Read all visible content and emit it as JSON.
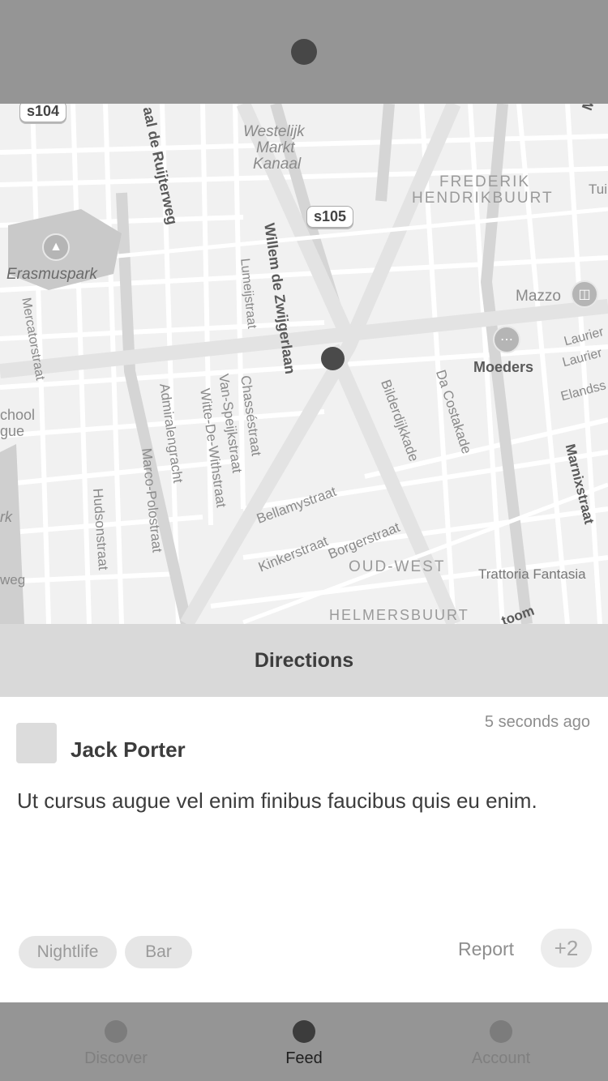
{
  "map": {
    "labels": {
      "westelijk": "Westelijk",
      "markt": "Markt",
      "kanaal": "Kanaal",
      "frederik": "FREDERIK",
      "hendrikbuurt": "HENDRIKBUURT",
      "erasmuspark": "Erasmuspark",
      "mazzo": "Mazzo",
      "moeders": "Moeders",
      "de_ruijterweg": "aal de Ruijterweg",
      "willem": "Willem de Zwijgerlaan",
      "lumeijstraat": "Lumeijstraat",
      "mercatorstraat": "Mercatorstraat",
      "admiralengracht": "Admiralengracht",
      "witte": "Witte-De-Withstraat",
      "van_speijk": "Van-Speijkstraat",
      "chasse": "Chasséstraat",
      "marco_polo": "Marco-Polostraat",
      "hudson": "Hudsonstraat",
      "bilderdijk": "Bilderdijkkade",
      "da_costa": "Da Costakade",
      "marnix": "Marnixstraat",
      "bellamy": "Bellamystraat",
      "kinker": "Kinkerstraat",
      "borger": "Borgerstraat",
      "oud_west": "OUD-WEST",
      "helmersbuurt": "HELMERSBUURT",
      "trattoria": "Trattoria Fantasia",
      "laurier1": "Laurier",
      "laurier2": "Laurier",
      "elands": "Elandss",
      "school": "chool",
      "gue": "gue",
      "rk": "rk",
      "weg": "weg",
      "ma": "Ma",
      "tui": "Tui",
      "toom": "toom"
    },
    "shields": {
      "s104": "s104",
      "s105": "s105"
    },
    "icons": {
      "park": "tree-icon",
      "mazzo": "basket-icon",
      "moeders": "fork-knife-icon"
    }
  },
  "directions": {
    "label": "Directions"
  },
  "post": {
    "author": "Jack Porter",
    "timestamp": "5 seconds ago",
    "text": "Ut cursus augue vel enim finibus faucibus quis eu enim.",
    "tags": [
      "Nightlife",
      "Bar"
    ],
    "report_label": "Report",
    "plus_label": "+2"
  },
  "tabs": [
    {
      "label": "Discover",
      "icon": "dot-icon",
      "active": false
    },
    {
      "label": "Feed",
      "icon": "dot-icon",
      "active": true
    },
    {
      "label": "Account",
      "icon": "dot-icon",
      "active": false
    }
  ],
  "colors": {
    "bar": "#959595",
    "directions_bg": "#d9d9d9",
    "tag_bg": "#e6e6e6",
    "active_dot": "#3c3c3c"
  }
}
